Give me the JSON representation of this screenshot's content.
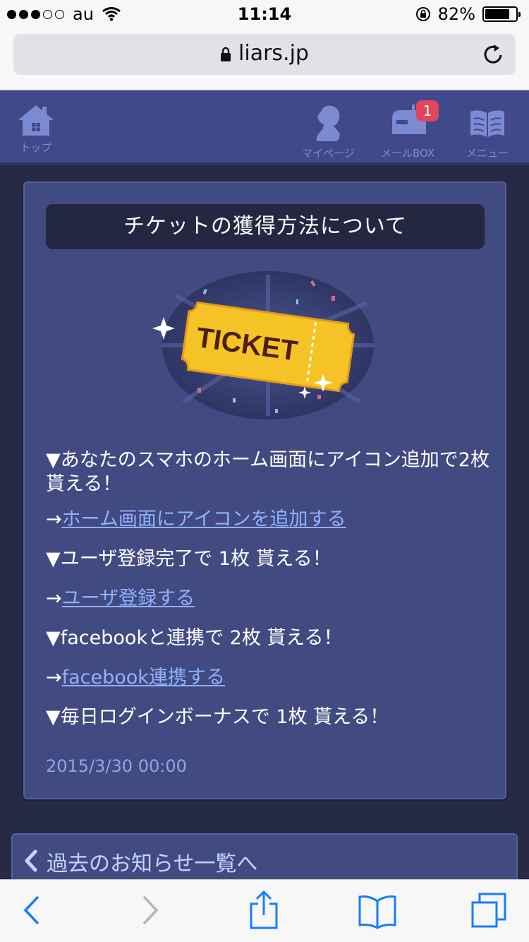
{
  "status_bar": {
    "carrier": "au",
    "time": "11:14",
    "battery_percent": "82%",
    "battery_level": 0.82,
    "signal_bars_filled": 3,
    "signal_bars_total": 5
  },
  "browser": {
    "url": "liars.jp"
  },
  "site_nav": {
    "top_label": "トップ",
    "mypage_label": "マイページ",
    "mailbox_label": "メールBOX",
    "mailbox_badge": "1",
    "menu_label": "メニュー"
  },
  "article": {
    "title": "チケットの獲得方法について",
    "image_text": "TICKET",
    "line1": "▼あなたのスマホのホーム画面にアイコン追加で2枚 貰える！",
    "link1_arrow": "→",
    "link1": "ホーム画面にアイコンを追加する",
    "line2": "▼ユーザ登録完了で 1枚 貰える！",
    "link2_arrow": "→",
    "link2": "ユーザ登録する",
    "line3": "▼facebookと連携で 2枚 貰える！",
    "link3_arrow": "→",
    "link3": "facebook連携する",
    "line4": "▼毎日ログインボーナスで 1枚 貰える！",
    "date": "2015/3/30 00:00"
  },
  "prev_link": {
    "label": "過去のお知らせ一覧へ"
  },
  "colors": {
    "page_bg": "#262a45",
    "header_bg": "#40498a",
    "card_bg": "#424a82",
    "title_bg": "#232742",
    "link": "#8fb2ff",
    "badge": "#e0455c",
    "ios_blue": "#157efb"
  }
}
